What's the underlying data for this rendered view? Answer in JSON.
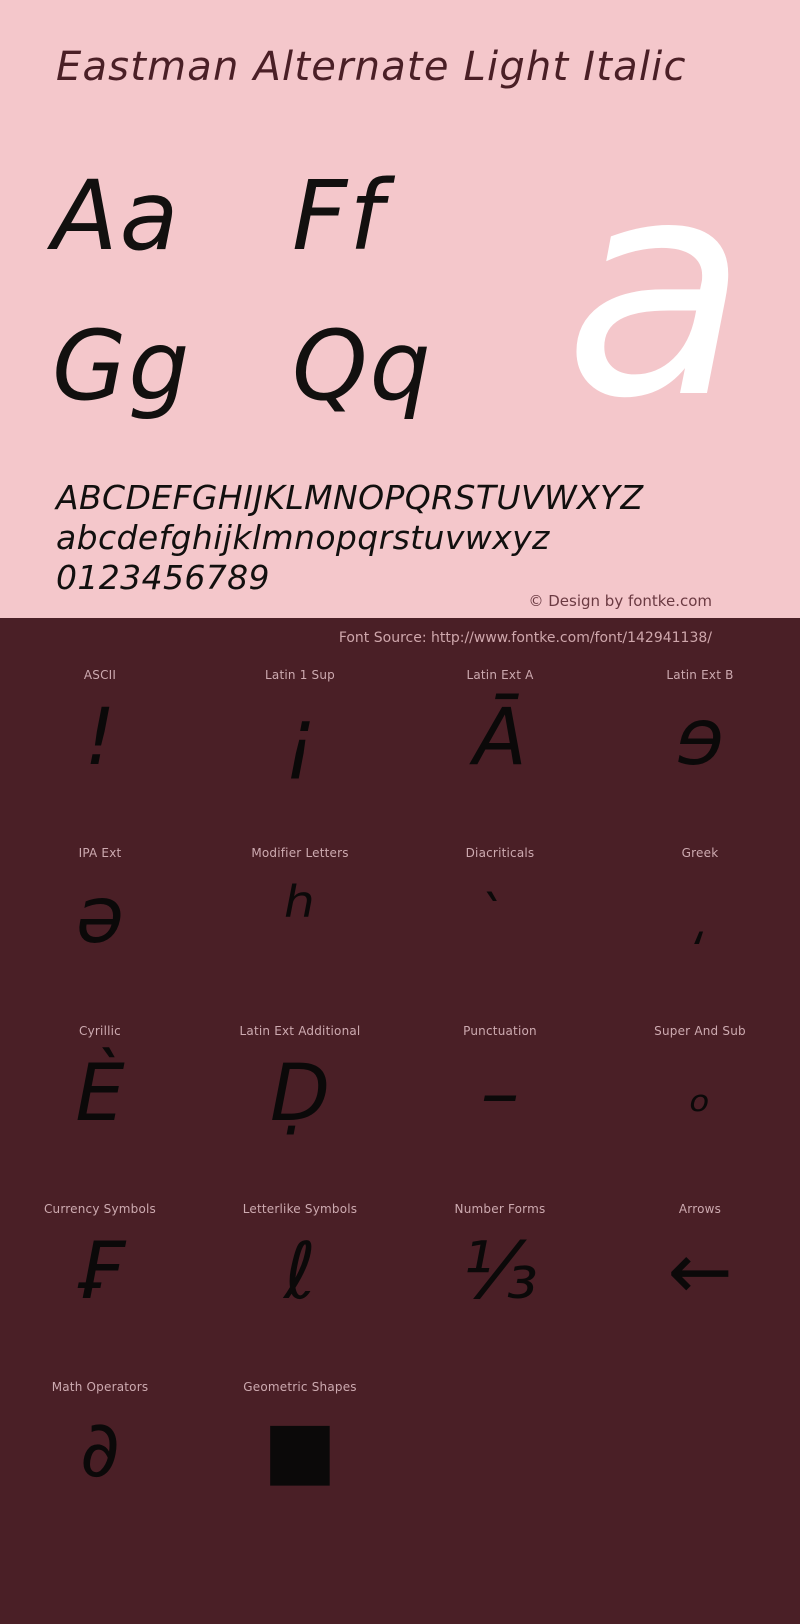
{
  "header": {
    "font_title": "Eastman Alternate Light Italic"
  },
  "showcase": {
    "hero_glyph": "a",
    "pairs": [
      {
        "label": "Aa"
      },
      {
        "label": "Ff"
      },
      {
        "label": "Gg"
      },
      {
        "label": "Qq"
      }
    ]
  },
  "alphabet": {
    "uppercase": "ABCDEFGHIJKLMNOPQRSTUVWXYZ",
    "lowercase": "abcdefghijklmnopqrstuvwxyz",
    "digits": "0123456789"
  },
  "credit": {
    "text": "© Design by fontke.com"
  },
  "source": {
    "text": "Font Source: http://www.fontke.com/font/142941138/"
  },
  "colors": {
    "top_background": "#f4c7cb",
    "bottom_background": "#4a1f26",
    "glyph": "#0b0909",
    "hero_glyph": "#ffffff",
    "label": "#cdaab0",
    "title": "#4a1f26"
  },
  "unicode_blocks": [
    {
      "label": "ASCII",
      "sample": "!"
    },
    {
      "label": "Latin 1 Sup",
      "sample": "¡"
    },
    {
      "label": "Latin Ext A",
      "sample": "Ā"
    },
    {
      "label": "Latin Ext B",
      "sample": "ɘ"
    },
    {
      "label": "IPA Ext",
      "sample": "ə"
    },
    {
      "label": "Modifier Letters",
      "sample": "ʰ"
    },
    {
      "label": "Diacriticals",
      "sample": "̀"
    },
    {
      "label": "Greek",
      "sample": "͵"
    },
    {
      "label": "Cyrillic",
      "sample": "Ѐ"
    },
    {
      "label": "Latin Ext Additional",
      "sample": "Ḍ"
    },
    {
      "label": "Punctuation",
      "sample": "–"
    },
    {
      "label": "Super And Sub",
      "sample": "ₒ"
    },
    {
      "label": "Currency Symbols",
      "sample": "₣"
    },
    {
      "label": "Letterlike Symbols",
      "sample": "ℓ"
    },
    {
      "label": "Number Forms",
      "sample": "⅓"
    },
    {
      "label": "Arrows",
      "sample": "←"
    },
    {
      "label": "Math Operators",
      "sample": "∂"
    },
    {
      "label": "Geometric Shapes",
      "sample": "■"
    }
  ]
}
